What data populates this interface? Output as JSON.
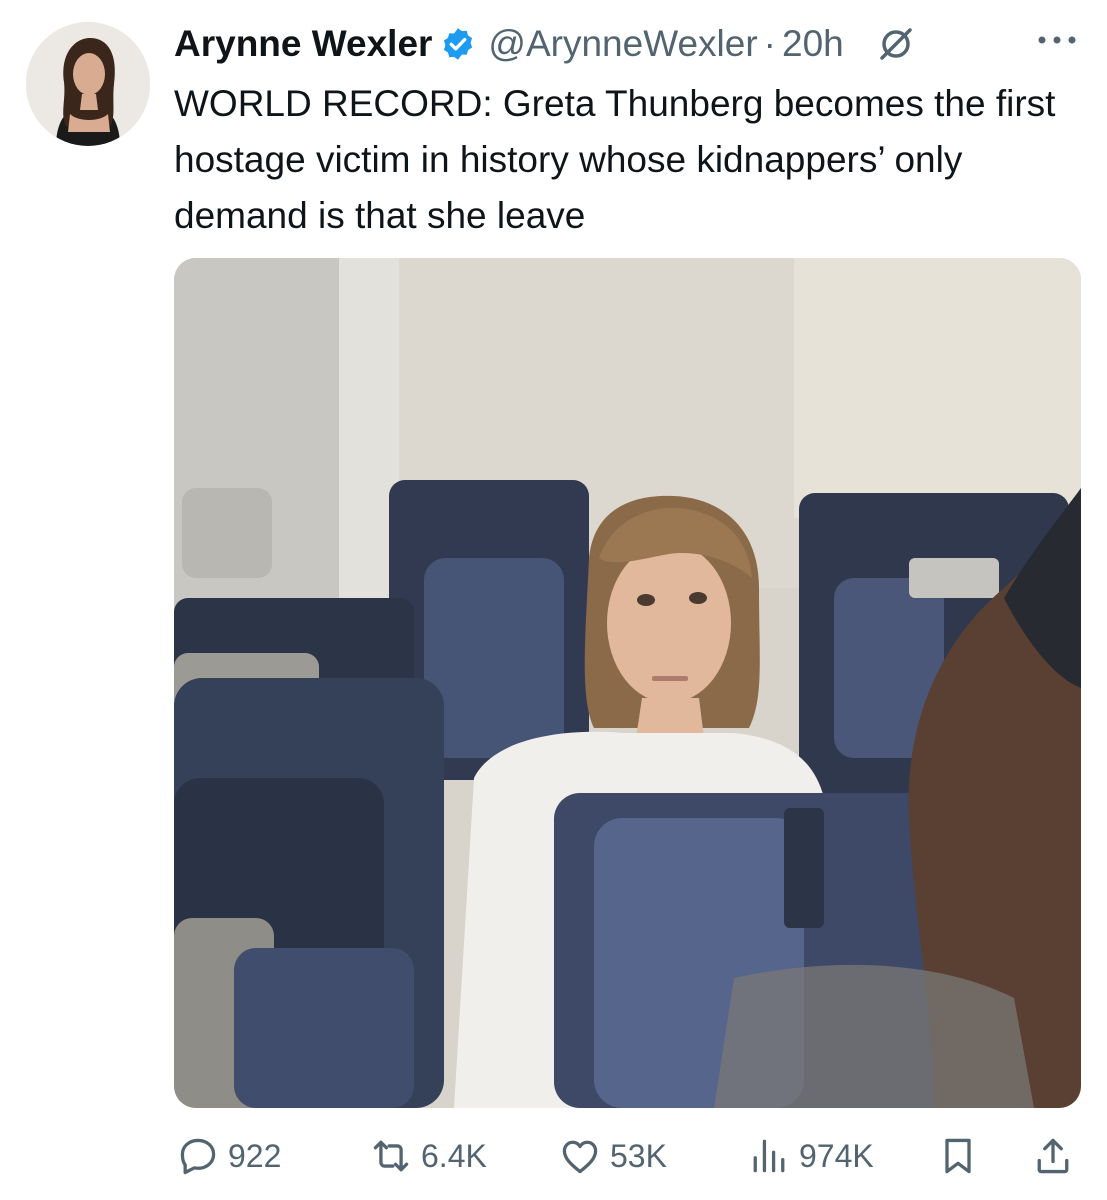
{
  "tweet": {
    "author_name": "Arynne Wexler",
    "author_handle": "@ArynneWexler",
    "separator": "·",
    "time": "20h",
    "text": "WORLD RECORD: Greta Thunberg becomes the first hostage victim in history whose kidnappers’ only demand is that she leave",
    "verified_icon": "verified-badge-icon",
    "grok_icon": "grok-icon",
    "more_icon": "more-icon"
  },
  "actions": {
    "reply_count": "922",
    "retweet_count": "6.4K",
    "like_count": "53K",
    "views_count": "974K",
    "icons": [
      "reply-icon",
      "retweet-icon",
      "like-icon",
      "views-icon",
      "bookmark-icon",
      "share-icon"
    ]
  },
  "colors": {
    "text": "#0f1419",
    "secondary": "#536471",
    "verified": "#1d9bf0"
  }
}
